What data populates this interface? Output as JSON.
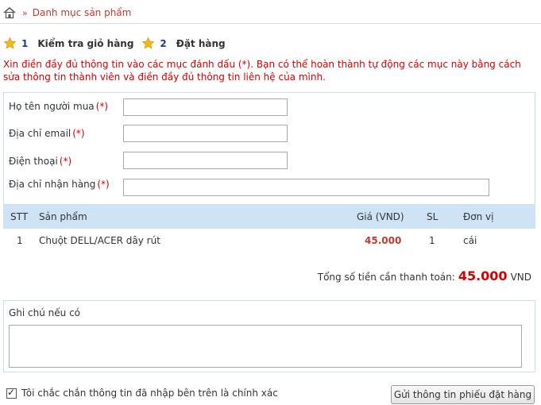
{
  "breadcrumb": {
    "separator": "»",
    "current": "Danh mục sản phẩm"
  },
  "steps": [
    {
      "num": "1",
      "label": "Kiểm tra giỏ hàng"
    },
    {
      "num": "2",
      "label": "Đặt hàng"
    }
  ],
  "notice": "Xin điền đầy đủ thông tin vào các mục đánh dấu (*). Bạn có thể hoàn thành tự động các mục này bằng cách sửa thông tin thành viên và điền đầy đủ thông tin liên hệ của mình.",
  "form": {
    "required_mark": "(*)",
    "name_label": "Họ tên người mua",
    "name_value": "",
    "email_label": "Địa chỉ email",
    "email_value": "",
    "phone_label": "Điện thoại",
    "phone_value": "",
    "address_label": "Địa chỉ nhận hàng",
    "address_value": ""
  },
  "table": {
    "headers": {
      "stt": "STT",
      "product": "Sản phẩm",
      "price": "Giá (VND)",
      "qty": "SL",
      "unit": "Đơn vị"
    },
    "rows": [
      {
        "stt": "1",
        "product": "Chuột DELL/ACER dây rút",
        "price": "45.000",
        "qty": "1",
        "unit": "cái"
      }
    ]
  },
  "total": {
    "label": "Tổng số tiền cần thanh toán:",
    "amount": "45.000",
    "currency": "VND"
  },
  "note": {
    "label": "Ghi chú nếu có",
    "value": ""
  },
  "confirm": {
    "label": "Tôi chắc chắn thông tin đã nhập bên trên là chính xác",
    "checked": true
  },
  "submit_label": "Gửi thông tin phiếu đặt hàng",
  "colors": {
    "accent_red": "#d40000",
    "header_bg": "#cfe3f7",
    "border_blue": "#c9ddf0"
  }
}
